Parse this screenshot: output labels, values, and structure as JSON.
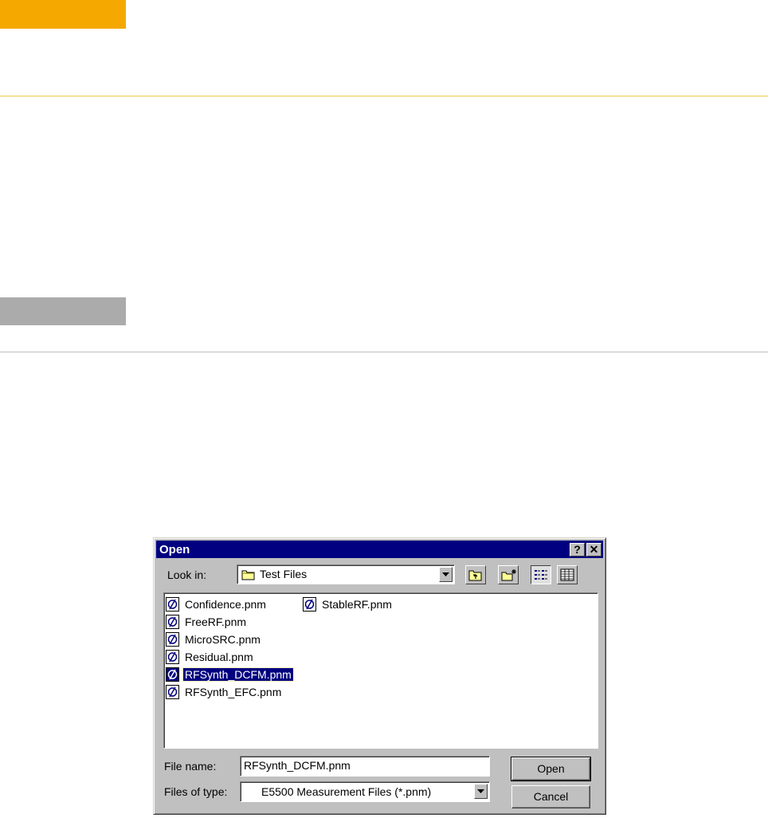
{
  "dialog": {
    "title": "Open",
    "help_label": "?",
    "close_label": "✕",
    "look_in_label": "Look in:",
    "look_in_value": "Test Files",
    "files": [
      {
        "name": "Confidence.pnm",
        "selected": false
      },
      {
        "name": "FreeRF.pnm",
        "selected": false
      },
      {
        "name": "MicroSRC.pnm",
        "selected": false
      },
      {
        "name": "Residual.pnm",
        "selected": false
      },
      {
        "name": "RFSynth_DCFM.pnm",
        "selected": true
      },
      {
        "name": "RFSynth_EFC.pnm",
        "selected": false
      },
      {
        "name": "StableRF.pnm",
        "selected": false
      }
    ],
    "file_name_label": "File name:",
    "file_name_value": "RFSynth_DCFM.pnm",
    "files_of_type_label": "Files of type:",
    "files_of_type_value": "E5500 Measurement Files (*.pnm)",
    "open_button": "Open",
    "cancel_button": "Cancel"
  },
  "colors": {
    "accent_orange": "#f5a800",
    "title_bar": "#000080",
    "dialog_face": "#c0c0c0",
    "gray_tab": "#ababab"
  },
  "icons": {
    "file": "pnm-file-icon",
    "folder": "folder-icon",
    "up": "up-one-level-icon",
    "new_folder": "create-new-folder-icon",
    "list_view": "list-view-icon",
    "details_view": "details-view-icon"
  }
}
